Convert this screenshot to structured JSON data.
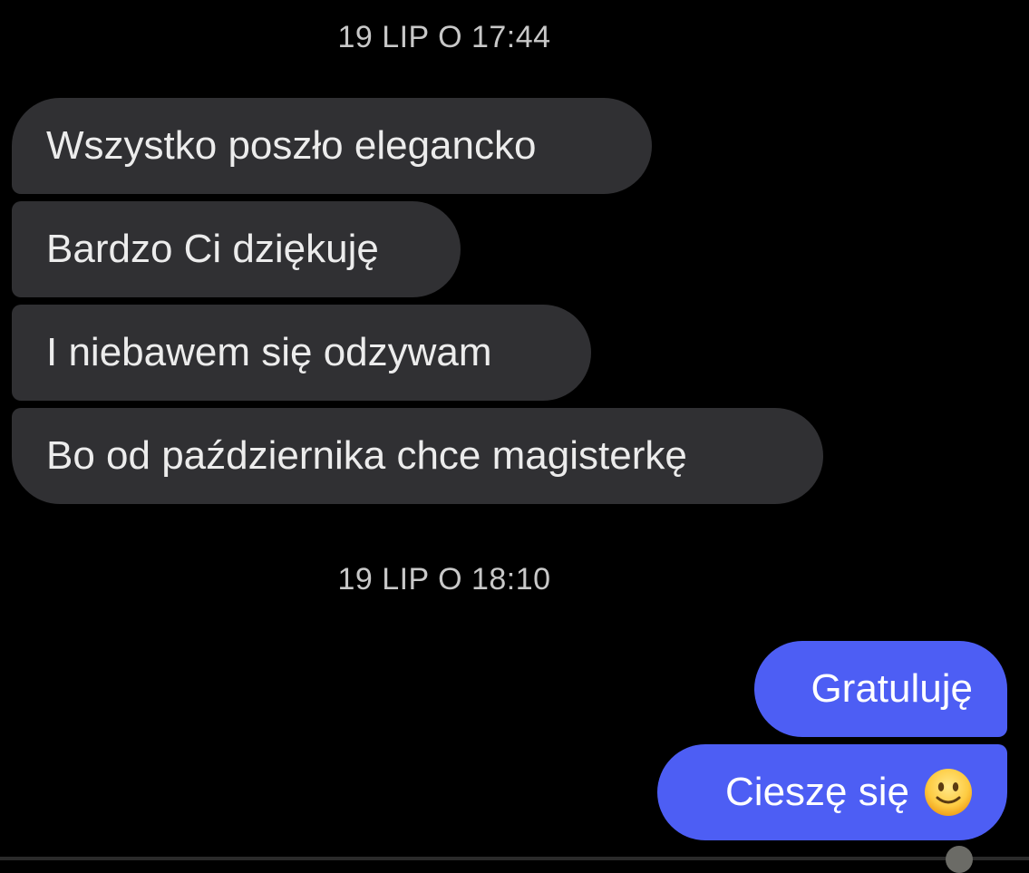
{
  "conversation": {
    "timestamps": [
      "19 LIP O 17:44",
      "19 LIP O 18:10"
    ],
    "incoming_messages": [
      "Wszystko poszło elegancko",
      "Bardzo Ci dziękuję",
      "I niebawem się odzywam",
      "Bo od października chce magisterkę"
    ],
    "outgoing_messages": [
      "Gratuluję",
      "Cieszę się"
    ],
    "outgoing_emoji": "slightly-smiling-face-icon"
  },
  "colors": {
    "background": "#000000",
    "incoming_bubble": "#303033",
    "outgoing_bubble": "#4d5ef4",
    "timestamp_text": "#c8c8c8",
    "message_text": "#ececec"
  }
}
